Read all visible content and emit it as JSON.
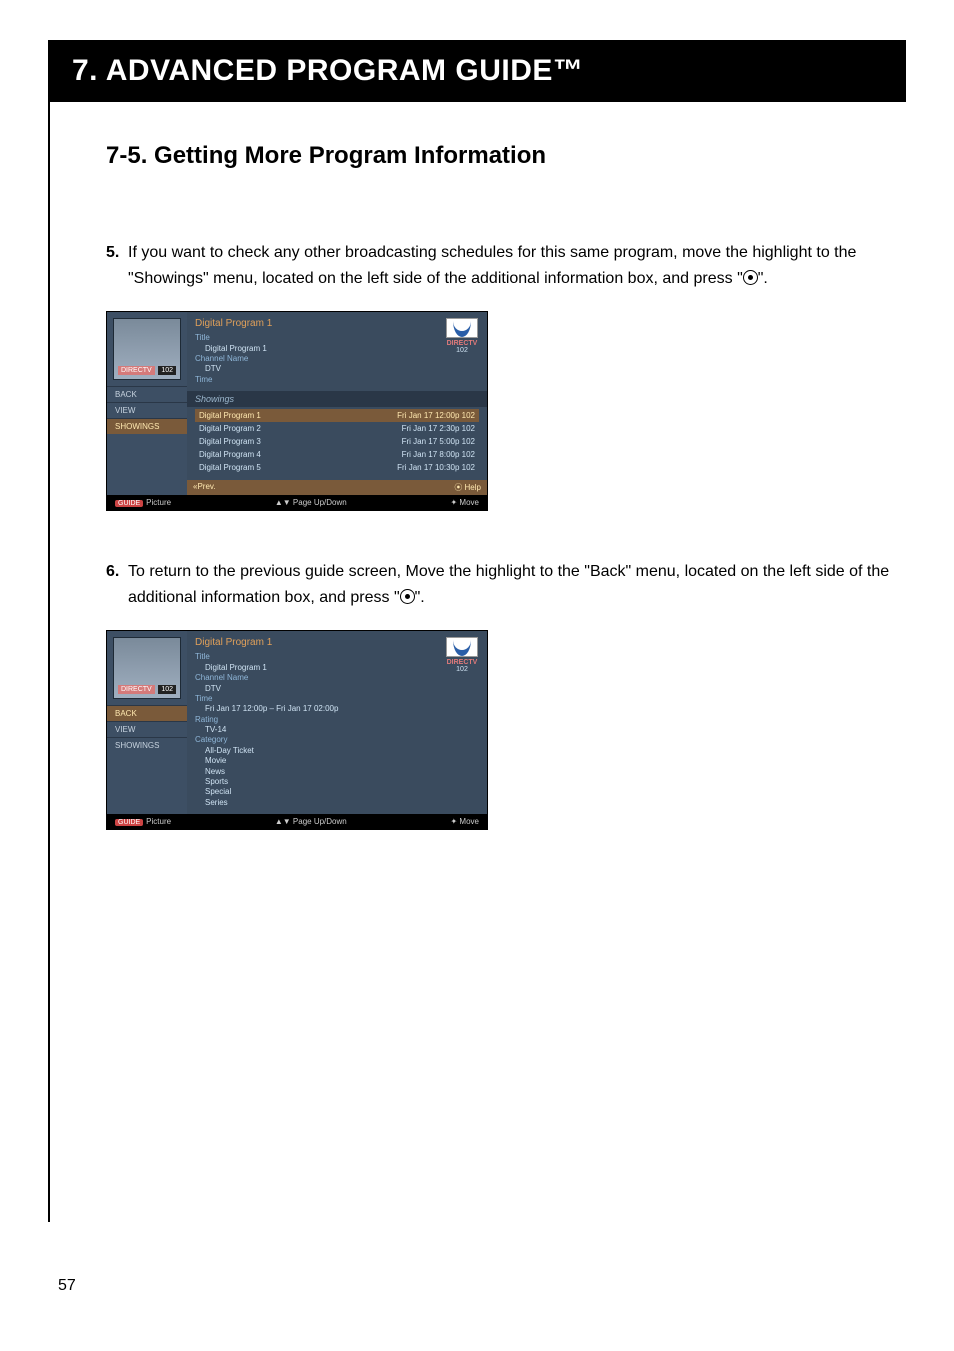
{
  "page": {
    "chapter_title": "7. ADVANCED PROGRAM GUIDE™",
    "section_title": "7-5. Getting More Program Information",
    "page_number": "57"
  },
  "steps": {
    "s5": {
      "num": "5.",
      "text_a": "If you want to check any other broadcasting schedules for this same program, move the highlight to the \"Showings\" menu, located on the left side of the additional information box, and press \"",
      "text_b": "\"."
    },
    "s6": {
      "num": "6.",
      "text_a": "To return to the previous guide screen, Move the highlight to the \"Back\" menu, located on the left side of the additional information box, and press \"",
      "text_b": "\"."
    }
  },
  "shot_common": {
    "channel_tag": "DIRECTV",
    "channel_num_thumb": "102",
    "program_title": "Digital Program 1",
    "brand": "DIRECTV",
    "channel_num": "102",
    "menu": {
      "back": "BACK",
      "view": "VIEW",
      "showings": "SHOWINGS"
    },
    "info": {
      "title_lbl": "Title",
      "title_val": "Digital Program 1",
      "chan_lbl": "Channel Name",
      "chan_val": "DTV",
      "time_lbl": "Time"
    },
    "bottom": {
      "picture": "Picture",
      "page": "Page Up/Down",
      "move": "Move"
    }
  },
  "shot1": {
    "showings_lbl": "Showings",
    "rows": [
      {
        "name": "Digital Program 1",
        "time": "Fri  Jan  17 12:00p  102"
      },
      {
        "name": "Digital Program 2",
        "time": "Fri  Jan  17  2:30p  102"
      },
      {
        "name": "Digital Program 3",
        "time": "Fri  Jan  17  5:00p  102"
      },
      {
        "name": "Digital Program 4",
        "time": "Fri  Jan  17  8:00p  102"
      },
      {
        "name": "Digital Program 5",
        "time": "Fri  Jan  17 10:30p  102"
      }
    ],
    "help": {
      "left": "«Prev.",
      "right": "⦿ Help"
    }
  },
  "shot2": {
    "time_val": "Fri Jan 17 12:00p – Fri Jan 17 02:00p",
    "rating_lbl": "Rating",
    "rating_val": "TV-14",
    "cat_lbl": "Category",
    "cats": [
      "All-Day Ticket",
      "Movie",
      "News",
      "Sports",
      "Special",
      "Series"
    ]
  }
}
